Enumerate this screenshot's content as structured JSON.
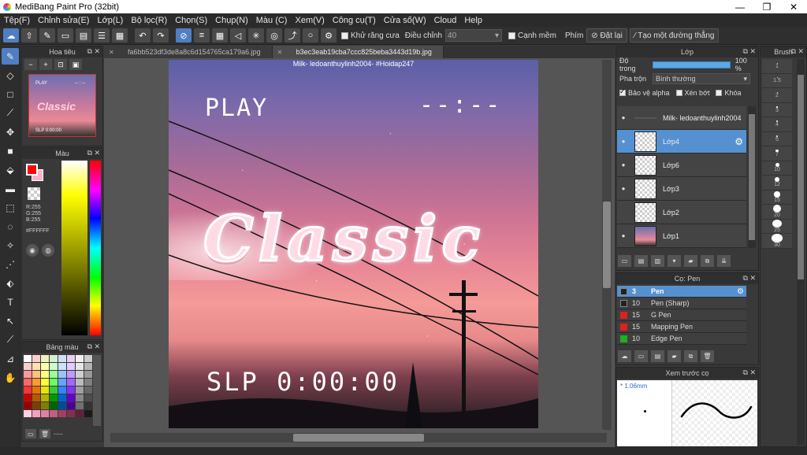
{
  "window": {
    "title": "MediBang Paint Pro (32bit)",
    "minimize": "—",
    "maximize": "❐",
    "close": "✕"
  },
  "menu": [
    "Tệp(F)",
    "Chỉnh sửa(E)",
    "Lớp(L)",
    "Bộ lọc(R)",
    "Chọn(S)",
    "Chụp(N)",
    "Màu (C)",
    "Xem(V)",
    "Công cụ(T)",
    "Cửa số(W)",
    "Cloud",
    "Help"
  ],
  "toolbar": {
    "antialias_label": "Khử răng cưa",
    "correction_label": "Điều chỉnh",
    "correction_value": "40",
    "smooth_label": "Cạnh mềm",
    "key_label": "Phím",
    "reset_label": "Đặt lại",
    "straight_line_label": "Tạo một đường thẳng"
  },
  "navigator": {
    "title": "Hoa tiêu",
    "thumb_play": "PLAY",
    "thumb_time": "-- : --",
    "thumb_classic": "Classic",
    "thumb_slp": "SLP 0:00:00"
  },
  "color": {
    "title": "Màu",
    "r": "R:255",
    "g": "G:255",
    "b": "B:255",
    "hex": "#FFFFFF",
    "fg": "#ff0000",
    "bg": "#ffb3c8"
  },
  "palette": {
    "title": "Bảng màu",
    "footer": "----"
  },
  "documents": {
    "tabs": [
      {
        "label": "fa6bb523df3de8a8c6d154765ca179a6.jpg",
        "active": false
      },
      {
        "label": "b3ec3eab19cba7ccc825beba3443d19b.jpg",
        "active": true
      }
    ]
  },
  "canvas": {
    "watermark": "Milk- ledoanthuylinh2004- #Hoidap247",
    "play": "PLAY",
    "time_top": "--:--",
    "classic": "Classic",
    "slp": "SLP 0:00:00"
  },
  "layers": {
    "title": "Lớp",
    "opacity_label": "Độ trong",
    "opacity_value": "100 %",
    "opacity": 1.0,
    "blend_label": "Pha trộn",
    "blend_value": "Bình thường",
    "protect_alpha": "Bảo vệ alpha",
    "clipping": "Xén bớt",
    "lock": "Khóa",
    "items": [
      {
        "name": "Milk- ledoanthuylinh2004",
        "active": false,
        "visible": true,
        "thumb": "line"
      },
      {
        "name": "Lớp4",
        "active": true,
        "visible": true,
        "thumb": "pink"
      },
      {
        "name": "Lớp6",
        "active": false,
        "visible": true,
        "thumb": "pink"
      },
      {
        "name": "Lớp3",
        "active": false,
        "visible": true,
        "thumb": "empty"
      },
      {
        "name": "Lớp2",
        "active": false,
        "visible": false,
        "thumb": "empty"
      },
      {
        "name": "Lớp1",
        "active": false,
        "visible": true,
        "thumb": "photo"
      }
    ]
  },
  "brushes": {
    "title": "Cọ: Pen",
    "items": [
      {
        "size": "3",
        "name": "Pen",
        "color": "#222222",
        "active": true
      },
      {
        "size": "10",
        "name": "Pen (Sharp)",
        "color": "#222222",
        "active": false
      },
      {
        "size": "15",
        "name": "G Pen",
        "color": "#e02020",
        "active": false
      },
      {
        "size": "15",
        "name": "Mapping Pen",
        "color": "#e02020",
        "active": false
      },
      {
        "size": "10",
        "name": "Edge Pen",
        "color": "#20b020",
        "active": false
      }
    ]
  },
  "preview": {
    "title": "Xem trước cọ",
    "size": "* 1.06mm"
  },
  "brush_size": {
    "title": "Brush",
    "items": [
      "1",
      "1.5",
      "2",
      "3",
      "4",
      "5",
      "7",
      "10",
      "12",
      "15",
      "20",
      "25",
      "30"
    ]
  },
  "colors": {
    "accent": "#4f7ec2",
    "active_layer": "#5591d0"
  }
}
